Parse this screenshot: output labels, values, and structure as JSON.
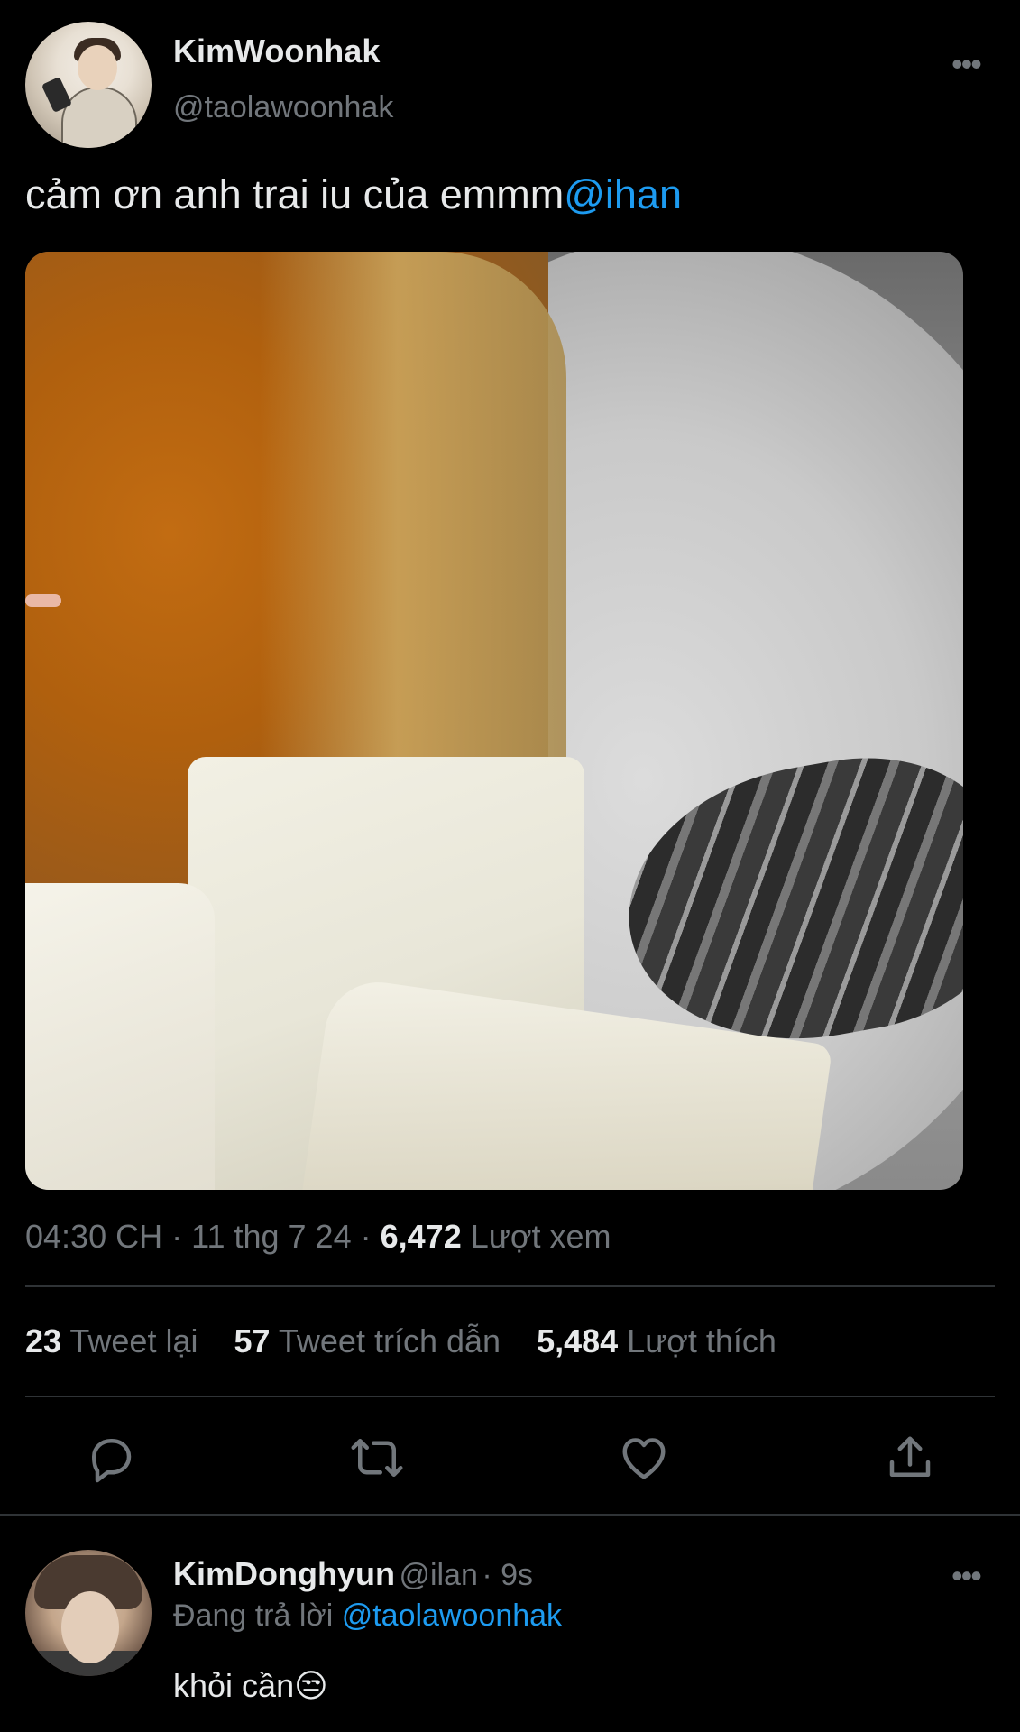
{
  "tweet": {
    "author_name": "KimWoonhak",
    "author_handle": "@taolawoonhak",
    "text": "cảm ơn anh trai iu của emmm",
    "text_mention": "@ihan",
    "more_icon": "more-icon",
    "media_description": "photo",
    "time": "04:30 CH",
    "date": "11 thg 7 24",
    "views_count": "6,472",
    "views_label": "Lượt xem",
    "retweets_count": "23",
    "retweets_label": "Tweet lại",
    "quotes_count": "57",
    "quotes_label": "Tweet trích dẫn",
    "likes_count": "5,484",
    "likes_label": "Lượt thích"
  },
  "actions": {
    "reply_icon": "reply-icon",
    "retweet_icon": "retweet-icon",
    "like_icon": "heart-icon",
    "share_icon": "share-icon"
  },
  "reply": {
    "author_name": "KimDonghyun",
    "author_handle": "@ilan",
    "time": "9s",
    "replying_prefix": "Đang trả lời",
    "replying_to": "@taolawoonhak",
    "text": "khỏi cần😒"
  },
  "colors": {
    "background": "#000000",
    "primary_text": "#e7e9ea",
    "secondary_text": "#71767b",
    "accent": "#1d9bf0",
    "divider": "#2f3336"
  }
}
